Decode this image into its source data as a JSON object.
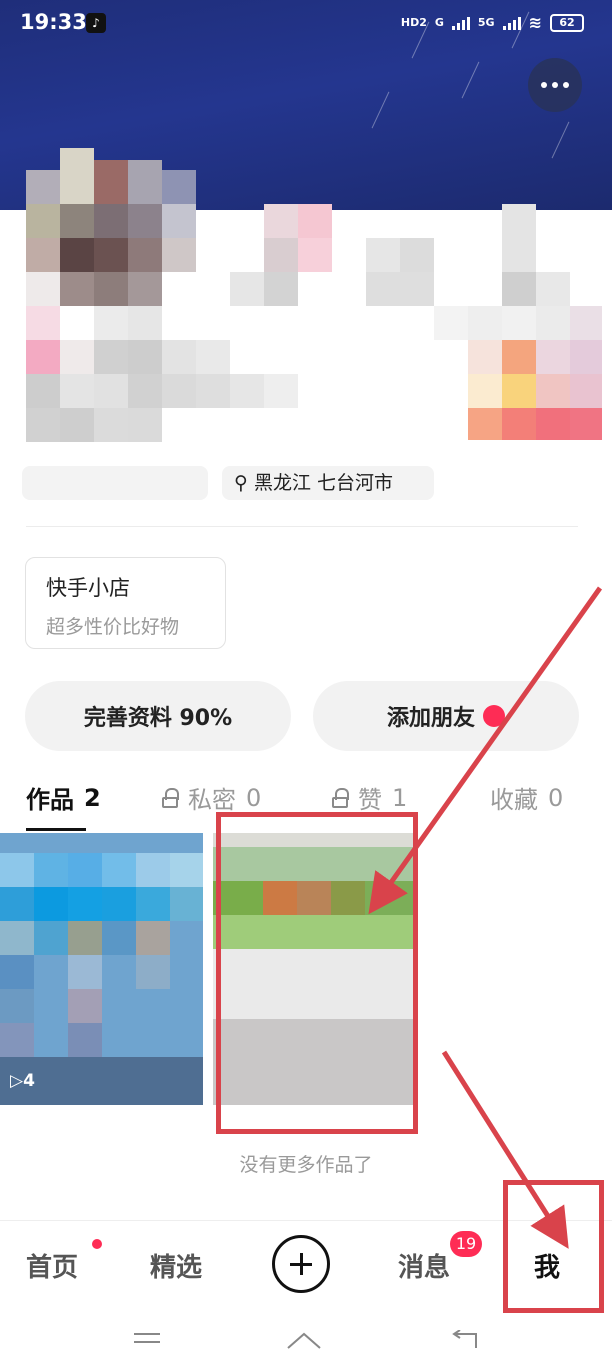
{
  "status_bar": {
    "time": "19:33",
    "network_hd": "HD2",
    "network_g": "G",
    "network_5g": "5G",
    "battery": "62"
  },
  "profile": {
    "location_tag": "黑龙江 七台河市"
  },
  "shop": {
    "title": "快手小店",
    "subtitle": "超多性价比好物"
  },
  "actions": {
    "complete_profile": "完善资料 90%",
    "add_friend": "添加朋友"
  },
  "tabs": [
    {
      "label": "作品",
      "count": "2"
    },
    {
      "label": "私密",
      "count": "0"
    },
    {
      "label": "赞",
      "count": "1"
    },
    {
      "label": "收藏",
      "count": "0"
    }
  ],
  "works": [
    {
      "play_count": "4"
    }
  ],
  "no_more_text": "没有更多作品了",
  "bottom_nav": {
    "home": "首页",
    "featured": "精选",
    "messages": "消息",
    "messages_badge": "19",
    "me": "我"
  },
  "colors": {
    "accent": "#fe2c55",
    "annotation": "#d9434b",
    "header": "#24368f"
  }
}
